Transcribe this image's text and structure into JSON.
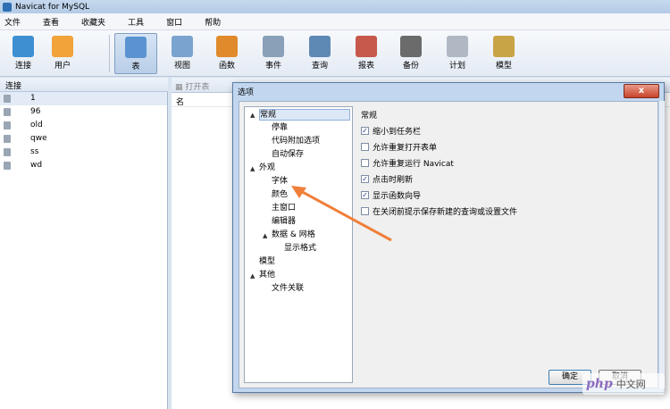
{
  "window": {
    "title": "Navicat for MySQL"
  },
  "menu": [
    "文件",
    "查看",
    "收藏夹",
    "工具",
    "窗口",
    "帮助"
  ],
  "toolbar": [
    {
      "label": "连接",
      "icon": "connection-icon",
      "color": "#3d8fd1"
    },
    {
      "label": "用户",
      "icon": "user-icon",
      "color": "#f2a33a"
    },
    {
      "label": "表",
      "icon": "table-icon",
      "color": "#5a93d0",
      "active": true
    },
    {
      "label": "视图",
      "icon": "view-icon",
      "color": "#7aa4cf"
    },
    {
      "label": "函数",
      "icon": "function-icon",
      "color": "#e08a2c"
    },
    {
      "label": "事件",
      "icon": "event-icon",
      "color": "#8aa0b8"
    },
    {
      "label": "查询",
      "icon": "query-icon",
      "color": "#5f89b5"
    },
    {
      "label": "报表",
      "icon": "report-icon",
      "color": "#c6584c"
    },
    {
      "label": "备份",
      "icon": "backup-icon",
      "color": "#6b6b6b"
    },
    {
      "label": "计划",
      "icon": "schedule-icon",
      "color": "#b0b8c4"
    },
    {
      "label": "模型",
      "icon": "model-icon",
      "color": "#c9a447"
    }
  ],
  "sidebar": {
    "header": "连接",
    "connections": [
      "1",
      "96",
      "old",
      "qwe",
      "ss",
      "wd"
    ],
    "selected": "1"
  },
  "main": {
    "open_table": "打开表",
    "column_header": "名"
  },
  "dialog": {
    "title": "选项",
    "close_label": "x",
    "tree": [
      {
        "label": "常规",
        "level": 0,
        "expanded": true,
        "selected": true
      },
      {
        "label": "停靠",
        "level": 1
      },
      {
        "label": "代码附加选项",
        "level": 1
      },
      {
        "label": "自动保存",
        "level": 1
      },
      {
        "label": "外观",
        "level": 0,
        "expanded": true
      },
      {
        "label": "字体",
        "level": 1
      },
      {
        "label": "颜色",
        "level": 1
      },
      {
        "label": "主窗口",
        "level": 1
      },
      {
        "label": "编辑器",
        "level": 1
      },
      {
        "label": "数据 & 网格",
        "level": 1,
        "expanded": true
      },
      {
        "label": "显示格式",
        "level": 2
      },
      {
        "label": "模型",
        "level": 0
      },
      {
        "label": "其他",
        "level": 0,
        "expanded": true
      },
      {
        "label": "文件关联",
        "level": 1
      }
    ],
    "section_title": "常规",
    "options": [
      {
        "label": "缩小到任务栏",
        "checked": true
      },
      {
        "label": "允许重复打开表单",
        "checked": false
      },
      {
        "label": "允许重复运行 Navicat",
        "checked": false
      },
      {
        "label": "点击时刷新",
        "checked": true
      },
      {
        "label": "显示函数向导",
        "checked": true
      },
      {
        "label": "在关闭前提示保存新建的查询或设置文件",
        "checked": false
      }
    ],
    "ok_label": "确定",
    "cancel_label": "取消"
  },
  "watermark": {
    "logo": "php",
    "text": "中文网"
  },
  "colors": {
    "arrow": "#f07f3a",
    "selection": "#dce8f7"
  }
}
